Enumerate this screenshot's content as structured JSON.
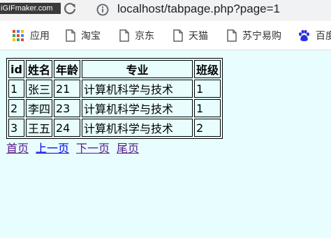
{
  "watermark": "iGIFmaker.com",
  "address": {
    "url": "localhost/tabpage.php?page=1"
  },
  "bookmarks": [
    {
      "label": "应用",
      "icon": "apps-grid-icon"
    },
    {
      "label": "淘宝",
      "icon": "page-icon"
    },
    {
      "label": "京东",
      "icon": "page-icon"
    },
    {
      "label": "天猫",
      "icon": "page-icon"
    },
    {
      "label": "苏宁易购",
      "icon": "page-icon"
    },
    {
      "label": "百度",
      "icon": "baidu-paw-icon"
    }
  ],
  "table": {
    "headers": [
      "id",
      "姓名",
      "年龄",
      "专业",
      "班级"
    ],
    "rows": [
      [
        "1",
        "张三",
        "21",
        "计算机科学与技术",
        "1"
      ],
      [
        "2",
        "李四",
        "23",
        "计算机科学与技术",
        "1"
      ],
      [
        "3",
        "王五",
        "24",
        "计算机科学与技术",
        "2"
      ]
    ]
  },
  "pager": {
    "first": "首页",
    "prev": "上一页",
    "next": "下一页",
    "last": "尾页"
  },
  "colors": {
    "page_bg": "#e8fdfd",
    "visited_link": "#551a8b",
    "link": "#0000ee",
    "baidu_blue": "#2932e1"
  }
}
